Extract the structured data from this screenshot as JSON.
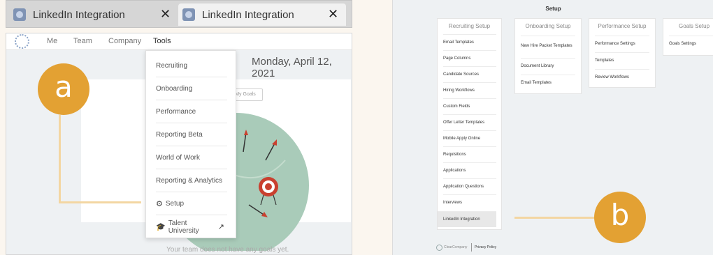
{
  "panel_a": {
    "tabs": [
      {
        "title": "LinkedIn Integration",
        "close": "✕"
      },
      {
        "title": "LinkedIn Integration",
        "close": "✕"
      }
    ],
    "nav": [
      "Me",
      "Team",
      "Company",
      "Tools"
    ],
    "date": "Monday, April 12, 2021",
    "goals_button": "My Goals",
    "empty_message": "Your team does not have any goals yet.",
    "tools_menu": [
      "Recruiting",
      "Onboarding",
      "Performance",
      "Reporting Beta",
      "World of Work",
      "Reporting & Analytics",
      "Setup",
      "Talent University"
    ],
    "badge": "a"
  },
  "panel_b": {
    "title": "Setup",
    "cards": {
      "recruiting": {
        "title": "Recruiting Setup",
        "items": [
          "Email Templates",
          "Page Columns",
          "Candidate Sources",
          "Hiring Workflows",
          "Custom Fields",
          "Offer Letter Templates",
          "Mobile Apply Online",
          "Requisitions",
          "Applications",
          "Application Questions",
          "Interviews",
          "LinkedIn Integration"
        ]
      },
      "onboarding": {
        "title": "Onboarding Setup",
        "items": [
          "New Hire Packet Templates",
          "Document Library",
          "Email Templates"
        ]
      },
      "performance": {
        "title": "Performance Setup",
        "items": [
          "Performance Settings",
          "Templates",
          "Review Workflows"
        ]
      },
      "goals": {
        "title": "Goals Setup",
        "items": [
          "Goals Settings"
        ]
      }
    },
    "footer": {
      "company": "ClearCompany",
      "privacy": "Privacy Policy"
    },
    "badge": "b"
  },
  "colors": {
    "badge": "#e3a133",
    "callout_line": "#f3d6a2",
    "illustration_green": "#a9cbb9",
    "target_red": "#c9402f"
  }
}
